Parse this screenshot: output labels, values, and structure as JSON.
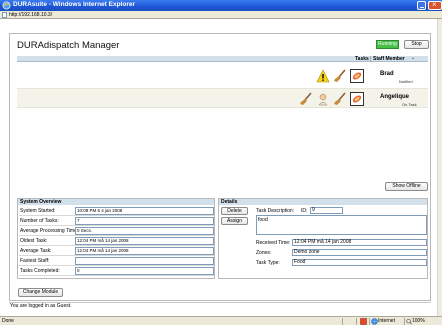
{
  "window": {
    "title": "DURAsuite - Windows Internet Explorer",
    "url": "http://192.168.10.3/"
  },
  "app": {
    "title": "DURAdispatch Manager",
    "status": "Running",
    "stop_label": "Stop"
  },
  "tasks_table": {
    "header_tasks": "Tasks",
    "header_staff": "Staff Member",
    "rows": [
      {
        "name": "Brad",
        "status": "Notified",
        "tasks": [
          "warning-icon",
          "broom-icon",
          "food-tray-icon"
        ]
      },
      {
        "name": "Angelique",
        "status": "On Task",
        "tasks": [
          "broom-icon",
          "person-icon",
          "broom-icon",
          "food-tray-icon"
        ]
      }
    ]
  },
  "show_offline_label": "Show Offline",
  "system_overview": {
    "title": "System Overview",
    "rows": [
      {
        "label": "System Started:",
        "value": "10:08 PM 6 4 jan 2008"
      },
      {
        "label": "Number of Tasks:",
        "value": "7"
      },
      {
        "label": "Average Processing Time:",
        "value": "0 Secs."
      },
      {
        "label": "Oldest Task:",
        "value": "12:04 PM må 14 jan 2008"
      },
      {
        "label": "Average Task:",
        "value": "12:04 PM må 14 jan 2008"
      },
      {
        "label": "Fastest Staff:",
        "value": ""
      },
      {
        "label": "Tasks Completed:",
        "value": "0"
      }
    ]
  },
  "details": {
    "title": "Details",
    "delete_label": "Delete",
    "assign_label": "Assign",
    "task_description_label": "Task Description:",
    "id_label": "ID:",
    "id_value": "9",
    "description_value": "food",
    "received_time_label": "Received Time:",
    "received_time_value": "12:04 PM må 14 jan 2008",
    "zones_label": "Zones:",
    "zones_value": "Demo zone",
    "task_type_label": "Task Type:",
    "task_type_value": "Food"
  },
  "change_module_label": "Change Module",
  "login_text": "You are logged in as Guest.",
  "statusbar": {
    "done": "Done",
    "zone": "Internet",
    "zoom": "100%"
  },
  "colors": {
    "titlebar": "#1d56d6",
    "running": "#48c048",
    "header": "#d2e0ec"
  }
}
